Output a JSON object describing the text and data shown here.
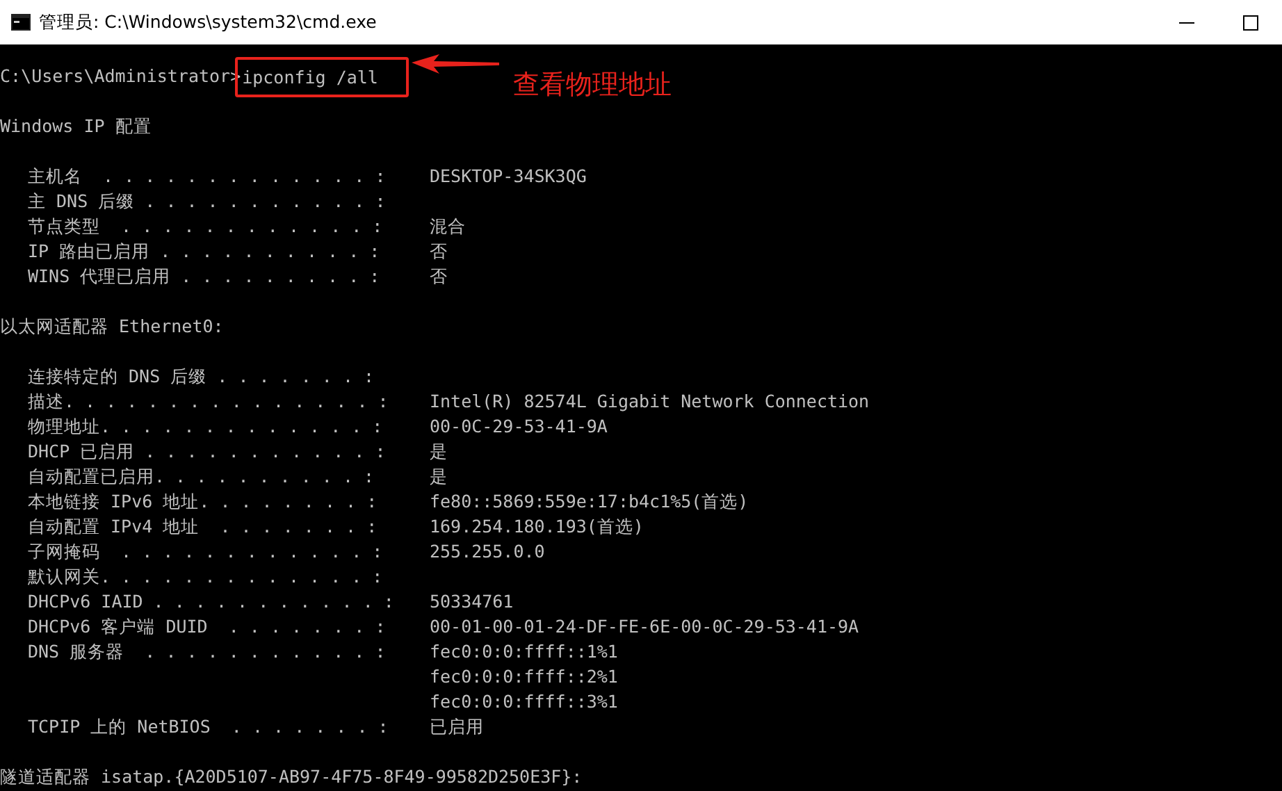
{
  "window": {
    "title": "管理员: C:\\Windows\\system32\\cmd.exe"
  },
  "console": {
    "prompt": "C:\\Users\\Administrator>",
    "command": "ipconfig /all",
    "sections": [
      {
        "heading": "Windows IP 配置",
        "entries": [
          {
            "label": "主机名  . . . . . . . . . . . . . :",
            "values": [
              "DESKTOP-34SK3QG"
            ]
          },
          {
            "label": "主 DNS 后缀 . . . . . . . . . . . :"
          },
          {
            "label": "节点类型  . . . . . . . . . . . . :",
            "values": [
              "混合"
            ]
          },
          {
            "label": "IP 路由已启用 . . . . . . . . . . :",
            "values": [
              "否"
            ]
          },
          {
            "label": "WINS 代理已启用 . . . . . . . . . :",
            "values": [
              "否"
            ]
          }
        ]
      },
      {
        "heading": "以太网适配器 Ethernet0:",
        "entries": [
          {
            "label": "连接特定的 DNS 后缀 . . . . . . . :"
          },
          {
            "label": "描述. . . . . . . . . . . . . . . :",
            "values": [
              "Intel(R) 82574L Gigabit Network Connection"
            ]
          },
          {
            "label": "物理地址. . . . . . . . . . . . . :",
            "values": [
              "00-0C-29-53-41-9A"
            ]
          },
          {
            "label": "DHCP 已启用 . . . . . . . . . . . :",
            "values": [
              "是"
            ]
          },
          {
            "label": "自动配置已启用. . . . . . . . . . :",
            "values": [
              "是"
            ]
          },
          {
            "label": "本地链接 IPv6 地址. . . . . . . . :",
            "values": [
              "fe80::5869:559e:17:b4c1%5(首选)"
            ]
          },
          {
            "label": "自动配置 IPv4 地址  . . . . . . . :",
            "values": [
              "169.254.180.193(首选)"
            ]
          },
          {
            "label": "子网掩码  . . . . . . . . . . . . :",
            "values": [
              "255.255.0.0"
            ]
          },
          {
            "label": "默认网关. . . . . . . . . . . . . :"
          },
          {
            "label": "DHCPv6 IAID . . . . . . . . . . . :",
            "values": [
              "50334761"
            ]
          },
          {
            "label": "DHCPv6 客户端 DUID  . . . . . . . :",
            "values": [
              "00-01-00-01-24-DF-FE-6E-00-0C-29-53-41-9A"
            ]
          },
          {
            "label": "DNS 服务器  . . . . . . . . . . . :",
            "values": [
              "fec0:0:0:ffff::1%1",
              "fec0:0:0:ffff::2%1",
              "fec0:0:0:ffff::3%1"
            ]
          },
          {
            "label": "TCPIP 上的 NetBIOS  . . . . . . . :",
            "values": [
              "已启用"
            ]
          }
        ]
      },
      {
        "heading": "隧道适配器 isatap.{A20D5107-AB97-4F75-8F49-99582D250E3F}:"
      }
    ]
  },
  "annotation": {
    "text": "查看物理地址"
  }
}
